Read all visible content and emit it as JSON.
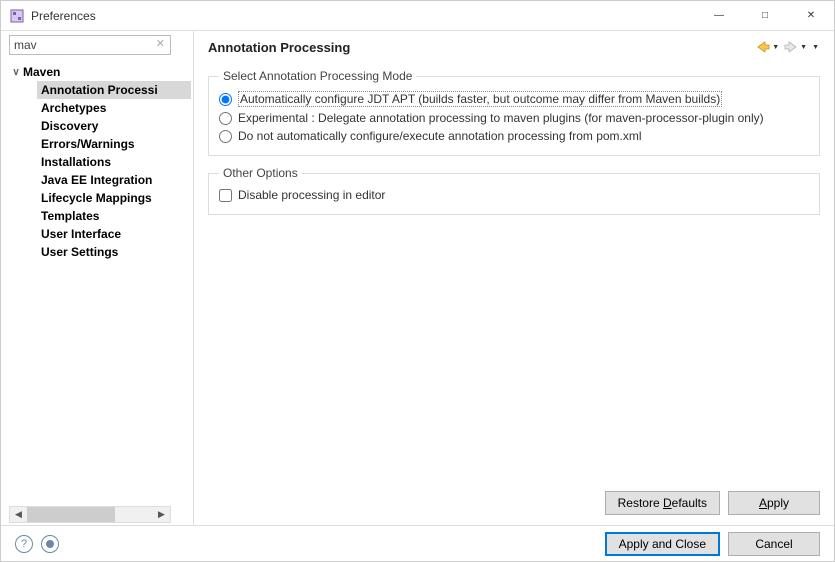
{
  "window": {
    "title": "Preferences"
  },
  "search": {
    "value": "mav"
  },
  "tree": {
    "parent": "Maven",
    "items": [
      "Annotation Processing",
      "Archetypes",
      "Discovery",
      "Errors/Warnings",
      "Installations",
      "Java EE Integration",
      "Lifecycle Mappings",
      "Templates",
      "User Interface",
      "User Settings"
    ],
    "selected_index": 0,
    "selected_display": "Annotation Processi"
  },
  "main": {
    "title": "Annotation Processing",
    "group1": {
      "legend": "Select Annotation Processing Mode",
      "options": [
        "Automatically configure JDT APT (builds faster, but outcome may differ from Maven builds)",
        "Experimental : Delegate annotation processing to maven plugins (for maven-processor-plugin only)",
        "Do not automatically configure/execute annotation processing from pom.xml"
      ],
      "selected": 0
    },
    "group2": {
      "legend": "Other Options",
      "checkbox": "Disable processing in editor",
      "checked": false
    },
    "buttons": {
      "restore": "Restore Defaults",
      "apply": "Apply"
    }
  },
  "footer": {
    "apply_close": "Apply and Close",
    "cancel": "Cancel"
  }
}
